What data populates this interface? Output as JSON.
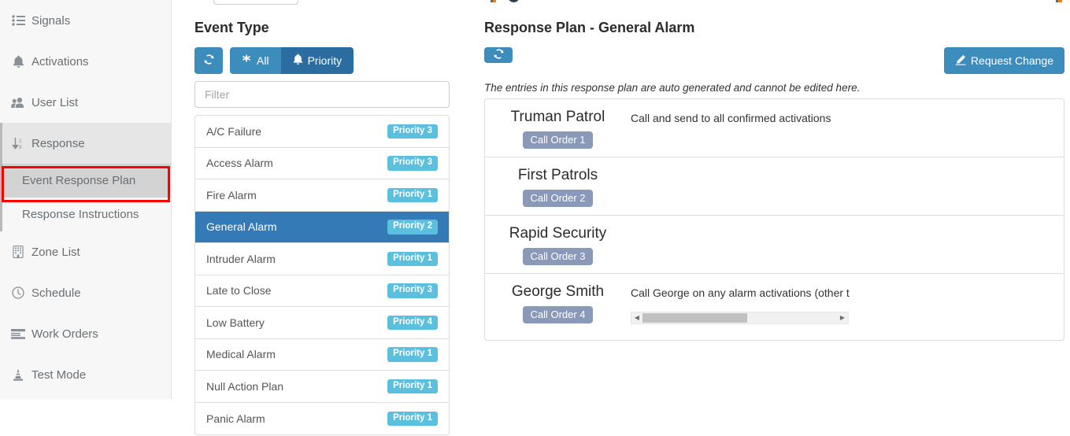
{
  "sidebar": {
    "items": [
      {
        "label": "Signals",
        "icon": "list-icon",
        "name": "sidebar-item-signals"
      },
      {
        "label": "Activations",
        "icon": "bell-icon",
        "name": "sidebar-item-activations"
      },
      {
        "label": "User List",
        "icon": "users-icon",
        "name": "sidebar-item-user-list"
      },
      {
        "label": "Response",
        "icon": "sort-numeric-icon",
        "name": "sidebar-item-response"
      }
    ],
    "sub_items": [
      {
        "label": "Event Response Plan",
        "name": "sidebar-subitem-event-response-plan",
        "selected": true
      },
      {
        "label": "Response Instructions",
        "name": "sidebar-subitem-response-instructions",
        "selected": false
      }
    ],
    "items_bottom": [
      {
        "label": "Zone List",
        "icon": "building-icon",
        "name": "sidebar-item-zone-list"
      },
      {
        "label": "Schedule",
        "icon": "clock-icon",
        "name": "sidebar-item-schedule"
      },
      {
        "label": "Work Orders",
        "icon": "tasks-icon",
        "name": "sidebar-item-work-orders"
      },
      {
        "label": "Test Mode",
        "icon": "cone-icon",
        "name": "sidebar-item-test-mode"
      }
    ],
    "annotation_color": "#ff0000"
  },
  "event_panel": {
    "title": "Event Type",
    "refresh_label": "",
    "all_label": "All",
    "priority_label": "Priority",
    "active_toggle": "Priority",
    "filter_placeholder": "Filter",
    "filter_value": "",
    "selected_event": "General Alarm",
    "rows": [
      {
        "label": "A/C Failure",
        "badge": "Priority 3",
        "selected": false
      },
      {
        "label": "Access Alarm",
        "badge": "Priority 3",
        "selected": false
      },
      {
        "label": "Fire Alarm",
        "badge": "Priority 1",
        "selected": false
      },
      {
        "label": "General Alarm",
        "badge": "Priority 2",
        "selected": true
      },
      {
        "label": "Intruder Alarm",
        "badge": "Priority 1",
        "selected": false
      },
      {
        "label": "Late to Close",
        "badge": "Priority 3",
        "selected": false
      },
      {
        "label": "Low Battery",
        "badge": "Priority 4",
        "selected": false
      },
      {
        "label": "Medical Alarm",
        "badge": "Priority 1",
        "selected": false
      },
      {
        "label": "Null Action Plan",
        "badge": "Priority 1",
        "selected": false
      },
      {
        "label": "Panic Alarm",
        "badge": "Priority 1",
        "selected": false
      }
    ]
  },
  "plan_panel": {
    "title": "Response Plan - General Alarm",
    "request_change_label": "Request Change",
    "note": "The entries in this response plan are auto generated and cannot be edited here.",
    "rows": [
      {
        "name": "Truman Patrol",
        "call_order": "Call Order 1",
        "description": "Call and send to all confirmed activations",
        "has_scrollbar": false
      },
      {
        "name": "First Patrols",
        "call_order": "Call Order 2",
        "description": "",
        "has_scrollbar": false
      },
      {
        "name": "Rapid Security",
        "call_order": "Call Order 3",
        "description": "",
        "has_scrollbar": false
      },
      {
        "name": "George Smith",
        "call_order": "Call Order 4",
        "description": "Call George on any alarm activations (other t",
        "has_scrollbar": true
      }
    ]
  },
  "colors": {
    "primary": "#3c8dbc",
    "primary_active": "#2b6da0",
    "selected_row": "#337ab7",
    "badge_priority": "#5bc0de",
    "badge_call_order": "#8b99b8",
    "annotation": "#ff0000"
  }
}
